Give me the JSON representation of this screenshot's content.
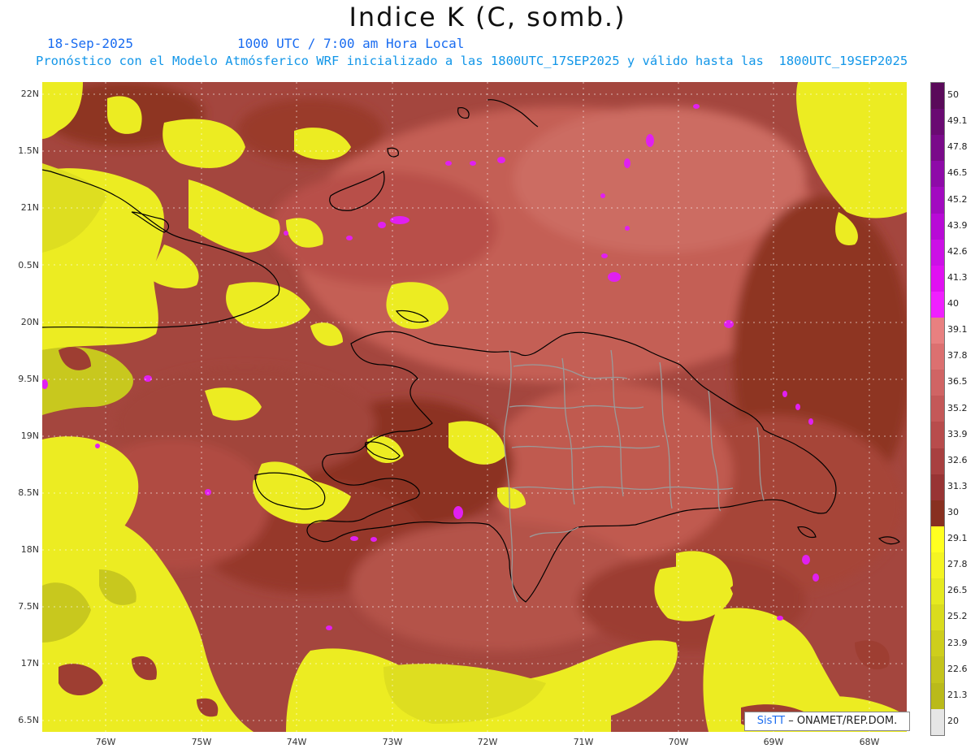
{
  "header": {
    "title": "Indice K (C, somb.)",
    "date": "18-Sep-2025",
    "time": "1000 UTC / 7:00 am Hora Local",
    "description": "Pronóstico con el Modelo Atmósferico WRF inicializado a las 1800UTC_17SEP2025 y válido hasta las  1800UTC_19SEP2025"
  },
  "axes": {
    "lat_labels": [
      "22N",
      "1.5N",
      "21N",
      "0.5N",
      "20N",
      "9.5N",
      "19N",
      "8.5N",
      "18N",
      "7.5N",
      "17N",
      "6.5N"
    ],
    "lon_labels": [
      "76W",
      "75W",
      "74W",
      "73W",
      "72W",
      "71W",
      "70W",
      "69W",
      "68W"
    ]
  },
  "colorbar": {
    "labels": [
      "50",
      "49.1",
      "47.8",
      "46.5",
      "45.2",
      "43.9",
      "42.6",
      "41.3",
      "40",
      "39.1",
      "37.8",
      "36.5",
      "35.2",
      "33.9",
      "32.6",
      "31.3",
      "30",
      "29.1",
      "27.8",
      "26.5",
      "25.2",
      "23.9",
      "22.6",
      "21.3",
      "20"
    ],
    "colors": [
      "#5a0a5a",
      "#6a0a72",
      "#7a0a8a",
      "#8e0aa8",
      "#a20ac0",
      "#b80ad6",
      "#cc10e6",
      "#e010f2",
      "#f020ff",
      "#e88080",
      "#dc7070",
      "#d06464",
      "#c45858",
      "#b84c4c",
      "#a84040",
      "#983434",
      "#883020",
      "#ffff20",
      "#f4f422",
      "#e6ea20",
      "#dadc1e",
      "#cece1c",
      "#c4c41c",
      "#baba1a",
      "#e6e6e6"
    ]
  },
  "credit": {
    "brand": "SisTT",
    "text": " – ONAMET/REP.DOM."
  }
}
